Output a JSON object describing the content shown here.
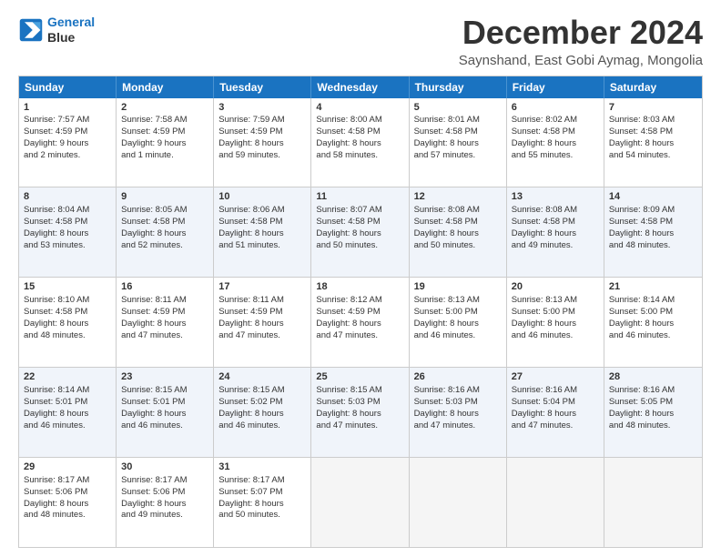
{
  "logo": {
    "line1": "General",
    "line2": "Blue"
  },
  "title": "December 2024",
  "subtitle": "Saynshand, East Gobi Aymag, Mongolia",
  "header_days": [
    "Sunday",
    "Monday",
    "Tuesday",
    "Wednesday",
    "Thursday",
    "Friday",
    "Saturday"
  ],
  "rows": [
    [
      {
        "day": "1",
        "lines": [
          "Sunrise: 7:57 AM",
          "Sunset: 4:59 PM",
          "Daylight: 9 hours",
          "and 2 minutes."
        ]
      },
      {
        "day": "2",
        "lines": [
          "Sunrise: 7:58 AM",
          "Sunset: 4:59 PM",
          "Daylight: 9 hours",
          "and 1 minute."
        ]
      },
      {
        "day": "3",
        "lines": [
          "Sunrise: 7:59 AM",
          "Sunset: 4:59 PM",
          "Daylight: 8 hours",
          "and 59 minutes."
        ]
      },
      {
        "day": "4",
        "lines": [
          "Sunrise: 8:00 AM",
          "Sunset: 4:58 PM",
          "Daylight: 8 hours",
          "and 58 minutes."
        ]
      },
      {
        "day": "5",
        "lines": [
          "Sunrise: 8:01 AM",
          "Sunset: 4:58 PM",
          "Daylight: 8 hours",
          "and 57 minutes."
        ]
      },
      {
        "day": "6",
        "lines": [
          "Sunrise: 8:02 AM",
          "Sunset: 4:58 PM",
          "Daylight: 8 hours",
          "and 55 minutes."
        ]
      },
      {
        "day": "7",
        "lines": [
          "Sunrise: 8:03 AM",
          "Sunset: 4:58 PM",
          "Daylight: 8 hours",
          "and 54 minutes."
        ]
      }
    ],
    [
      {
        "day": "8",
        "lines": [
          "Sunrise: 8:04 AM",
          "Sunset: 4:58 PM",
          "Daylight: 8 hours",
          "and 53 minutes."
        ]
      },
      {
        "day": "9",
        "lines": [
          "Sunrise: 8:05 AM",
          "Sunset: 4:58 PM",
          "Daylight: 8 hours",
          "and 52 minutes."
        ]
      },
      {
        "day": "10",
        "lines": [
          "Sunrise: 8:06 AM",
          "Sunset: 4:58 PM",
          "Daylight: 8 hours",
          "and 51 minutes."
        ]
      },
      {
        "day": "11",
        "lines": [
          "Sunrise: 8:07 AM",
          "Sunset: 4:58 PM",
          "Daylight: 8 hours",
          "and 50 minutes."
        ]
      },
      {
        "day": "12",
        "lines": [
          "Sunrise: 8:08 AM",
          "Sunset: 4:58 PM",
          "Daylight: 8 hours",
          "and 50 minutes."
        ]
      },
      {
        "day": "13",
        "lines": [
          "Sunrise: 8:08 AM",
          "Sunset: 4:58 PM",
          "Daylight: 8 hours",
          "and 49 minutes."
        ]
      },
      {
        "day": "14",
        "lines": [
          "Sunrise: 8:09 AM",
          "Sunset: 4:58 PM",
          "Daylight: 8 hours",
          "and 48 minutes."
        ]
      }
    ],
    [
      {
        "day": "15",
        "lines": [
          "Sunrise: 8:10 AM",
          "Sunset: 4:58 PM",
          "Daylight: 8 hours",
          "and 48 minutes."
        ]
      },
      {
        "day": "16",
        "lines": [
          "Sunrise: 8:11 AM",
          "Sunset: 4:59 PM",
          "Daylight: 8 hours",
          "and 47 minutes."
        ]
      },
      {
        "day": "17",
        "lines": [
          "Sunrise: 8:11 AM",
          "Sunset: 4:59 PM",
          "Daylight: 8 hours",
          "and 47 minutes."
        ]
      },
      {
        "day": "18",
        "lines": [
          "Sunrise: 8:12 AM",
          "Sunset: 4:59 PM",
          "Daylight: 8 hours",
          "and 47 minutes."
        ]
      },
      {
        "day": "19",
        "lines": [
          "Sunrise: 8:13 AM",
          "Sunset: 5:00 PM",
          "Daylight: 8 hours",
          "and 46 minutes."
        ]
      },
      {
        "day": "20",
        "lines": [
          "Sunrise: 8:13 AM",
          "Sunset: 5:00 PM",
          "Daylight: 8 hours",
          "and 46 minutes."
        ]
      },
      {
        "day": "21",
        "lines": [
          "Sunrise: 8:14 AM",
          "Sunset: 5:00 PM",
          "Daylight: 8 hours",
          "and 46 minutes."
        ]
      }
    ],
    [
      {
        "day": "22",
        "lines": [
          "Sunrise: 8:14 AM",
          "Sunset: 5:01 PM",
          "Daylight: 8 hours",
          "and 46 minutes."
        ]
      },
      {
        "day": "23",
        "lines": [
          "Sunrise: 8:15 AM",
          "Sunset: 5:01 PM",
          "Daylight: 8 hours",
          "and 46 minutes."
        ]
      },
      {
        "day": "24",
        "lines": [
          "Sunrise: 8:15 AM",
          "Sunset: 5:02 PM",
          "Daylight: 8 hours",
          "and 46 minutes."
        ]
      },
      {
        "day": "25",
        "lines": [
          "Sunrise: 8:15 AM",
          "Sunset: 5:03 PM",
          "Daylight: 8 hours",
          "and 47 minutes."
        ]
      },
      {
        "day": "26",
        "lines": [
          "Sunrise: 8:16 AM",
          "Sunset: 5:03 PM",
          "Daylight: 8 hours",
          "and 47 minutes."
        ]
      },
      {
        "day": "27",
        "lines": [
          "Sunrise: 8:16 AM",
          "Sunset: 5:04 PM",
          "Daylight: 8 hours",
          "and 47 minutes."
        ]
      },
      {
        "day": "28",
        "lines": [
          "Sunrise: 8:16 AM",
          "Sunset: 5:05 PM",
          "Daylight: 8 hours",
          "and 48 minutes."
        ]
      }
    ],
    [
      {
        "day": "29",
        "lines": [
          "Sunrise: 8:17 AM",
          "Sunset: 5:06 PM",
          "Daylight: 8 hours",
          "and 48 minutes."
        ]
      },
      {
        "day": "30",
        "lines": [
          "Sunrise: 8:17 AM",
          "Sunset: 5:06 PM",
          "Daylight: 8 hours",
          "and 49 minutes."
        ]
      },
      {
        "day": "31",
        "lines": [
          "Sunrise: 8:17 AM",
          "Sunset: 5:07 PM",
          "Daylight: 8 hours",
          "and 50 minutes."
        ]
      },
      {
        "day": "",
        "lines": []
      },
      {
        "day": "",
        "lines": []
      },
      {
        "day": "",
        "lines": []
      },
      {
        "day": "",
        "lines": []
      }
    ]
  ]
}
